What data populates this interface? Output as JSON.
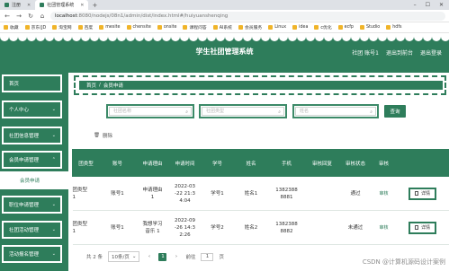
{
  "browser": {
    "tabs": [
      {
        "label": "注册"
      },
      {
        "label": "社团管理系统"
      }
    ],
    "new_tab": "+",
    "url_host": "localhost",
    "url_path": ":8080/nodejs/08n1/admin/dist/index.html#/huiyuanshenqing",
    "bookmarks": [
      "收藏",
      "京东(JD",
      "淘宝网",
      "百度",
      "mesite",
      "chensite",
      "onsite",
      "课程问答",
      "AI系统",
      "会员服务",
      "Linux",
      "idea",
      "c优化",
      "ecfp",
      "Studio",
      "hdfs"
    ]
  },
  "header": {
    "title": "学生社团管理系统",
    "user": "社团 账号1",
    "back_home": "退出到前台",
    "logout": "退出登录"
  },
  "sidebar": {
    "items": [
      {
        "label": "首页"
      },
      {
        "label": "个人中心"
      },
      {
        "label": "社团信息管理"
      },
      {
        "label": "会员申请管理"
      },
      {
        "label": "职位申请管理"
      },
      {
        "label": "社团活动管理"
      },
      {
        "label": "活动报名管理"
      }
    ],
    "submenu_label": "会员申请"
  },
  "breadcrumb": {
    "home": "首页",
    "sep": "/",
    "current": "会员申请"
  },
  "search": {
    "fields": [
      {
        "placeholder": "社团名称"
      },
      {
        "placeholder": "社团类型"
      },
      {
        "placeholder": "姓名"
      }
    ],
    "query_label": "查询"
  },
  "toolbar": {
    "delete_label": "删除"
  },
  "table": {
    "columns": [
      "团类型",
      "账号",
      "申请理由",
      "申请时间",
      "学号",
      "姓名",
      "手机",
      "审核回复",
      "审核状态",
      "审核",
      ""
    ],
    "rows": [
      {
        "type": "团类型\n1",
        "account": "账号1",
        "reason": "申请理由\n1",
        "time": "2022-03\n-22 21:3\n4:04",
        "sid": "学号1",
        "name": "姓名1",
        "phone": "1382388\n8881",
        "reply": "",
        "status": "通过",
        "audit": "审核",
        "detail": "详情"
      },
      {
        "type": "团类型\n1",
        "account": "账号1",
        "reason": "我想学习\n音乐 1",
        "time": "2022-09\n-26 14:3\n2:26",
        "sid": "学号2",
        "name": "姓名2",
        "phone": "1382388\n8882",
        "reply": "",
        "status": "未通过",
        "audit": "审核",
        "detail": "详情"
      }
    ]
  },
  "pager": {
    "total": "共 2 条",
    "size": "10条/页",
    "current": "1",
    "prev": "‹",
    "next": "›",
    "goto_prefix": "前往",
    "goto_value": "1",
    "goto_suffix": "页"
  },
  "watermark": "CSDN @计算机源码设计案例",
  "colors": {
    "primary": "#2e7d5b",
    "header": "#2e7d5b",
    "white": "#ffffff"
  }
}
